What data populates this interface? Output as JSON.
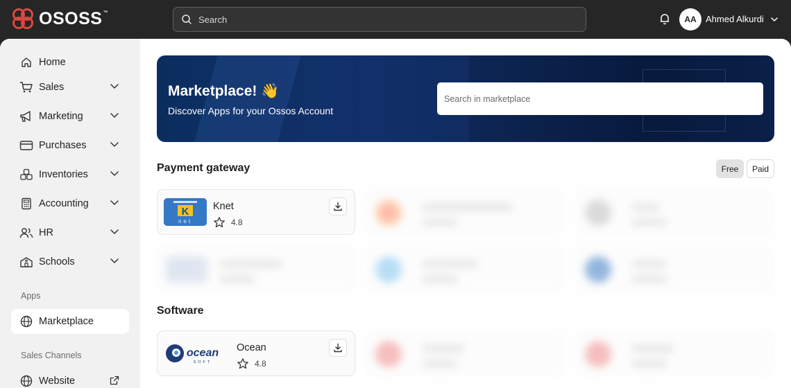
{
  "brand": {
    "name": "OSOSS",
    "tm": "™"
  },
  "search": {
    "placeholder": "Search"
  },
  "user": {
    "initials": "AA",
    "name": "Ahmed Alkurdi"
  },
  "sidebar": {
    "items": [
      {
        "label": "Home"
      },
      {
        "label": "Sales"
      },
      {
        "label": "Marketing"
      },
      {
        "label": "Purchases"
      },
      {
        "label": "Inventories"
      },
      {
        "label": "Accounting"
      },
      {
        "label": "HR"
      },
      {
        "label": "Schools"
      }
    ],
    "apps_section": "Apps",
    "apps_items": [
      {
        "label": "Marketplace"
      }
    ],
    "channels_section": "Sales Channels",
    "channels_items": [
      {
        "label": "Website"
      }
    ]
  },
  "hero": {
    "title": "Marketplace! 👋",
    "subtitle": "Discover Apps for your Ossos Account",
    "search_placeholder": "Search in marketplace"
  },
  "filters": {
    "free": "Free",
    "paid": "Paid",
    "selected": "Free"
  },
  "sections": [
    {
      "title": "Payment gateway",
      "apps": [
        {
          "name": "Knet",
          "rating": "4.8",
          "thumb_text": "net"
        }
      ]
    },
    {
      "title": "Software",
      "apps": [
        {
          "name": "Ocean",
          "rating": "4.8",
          "thumb_text": "ocean",
          "thumb_sub": "SOFT"
        }
      ]
    }
  ],
  "colors": {
    "topbar": "#262626",
    "brand_red": "#e0463e",
    "hero_dark": "#0b2d5e"
  }
}
